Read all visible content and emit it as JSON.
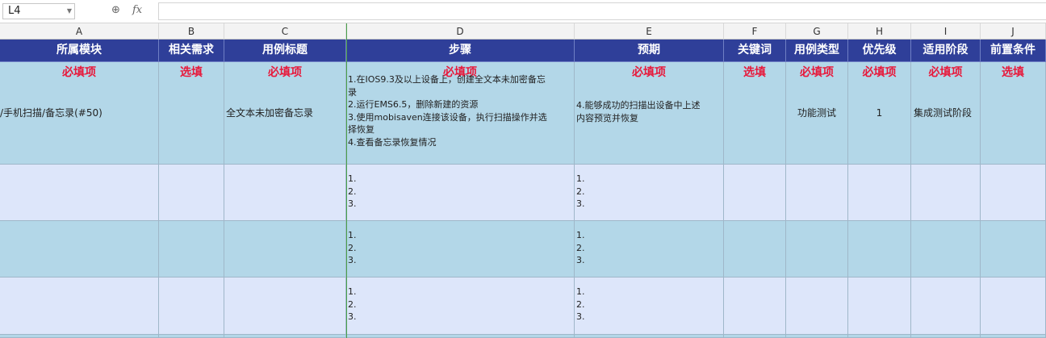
{
  "formula_bar": {
    "cell_ref": "L4",
    "fx_label": "fx"
  },
  "columns": [
    "A",
    "B",
    "C",
    "D",
    "E",
    "F",
    "G",
    "H",
    "I",
    "J"
  ],
  "header": [
    "所属模块",
    "相关需求",
    "用例标题",
    "步骤",
    "预期",
    "关键词",
    "用例类型",
    "优先级",
    "适用阶段",
    "前置条件"
  ],
  "requirement": [
    "必填项",
    "选填",
    "必填项",
    "必填项",
    "必填项",
    "选填",
    "必填项",
    "必填项",
    "必填项",
    "选填"
  ],
  "row1": {
    "module": "/手机扫描/备忘录(#50)",
    "title": "全文本未加密备忘录",
    "steps": [
      "1.在IOS9.3及以上设备上，创建全文本未加密备忘",
      "录",
      "2.运行EMS6.5，删除新建的资源",
      "3.使用mobisaven连接该设备，执行扫描操作并选",
      "择恢复",
      "4.查看备忘录恢复情况"
    ],
    "expected": [
      "4.能够成功的扫描出设备中上述",
      "内容预览并恢复"
    ],
    "case_type": "功能测试",
    "priority": "1",
    "stage": "集成测试阶段"
  },
  "template_rows": [
    {
      "steps": [
        "1.",
        "2.",
        "3."
      ],
      "expected": [
        "1.",
        "2.",
        "3."
      ]
    },
    {
      "steps": [
        "1.",
        "2.",
        "3."
      ],
      "expected": [
        "1.",
        "2.",
        "3."
      ]
    },
    {
      "steps": [
        "1.",
        "2.",
        "3."
      ],
      "expected": [
        "1.",
        "2.",
        "3."
      ]
    }
  ]
}
